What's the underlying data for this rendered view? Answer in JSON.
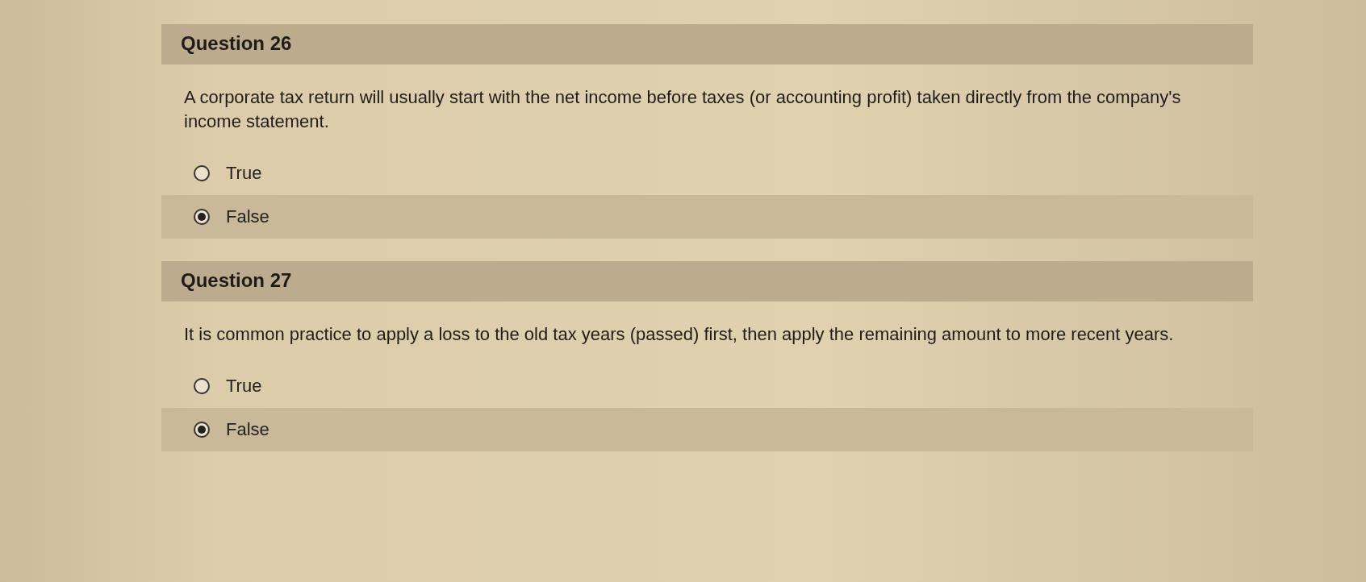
{
  "questions": [
    {
      "title": "Question 26",
      "text": "A corporate tax return will usually start with the net income before taxes (or accounting profit) taken directly from the company's income statement.",
      "options": [
        {
          "label": "True",
          "selected": false
        },
        {
          "label": "False",
          "selected": true
        }
      ]
    },
    {
      "title": "Question 27",
      "text": "It is common practice to apply a loss to the old tax years (passed) first, then apply the remaining amount to more recent years.",
      "options": [
        {
          "label": "True",
          "selected": false
        },
        {
          "label": "False",
          "selected": true
        }
      ]
    }
  ]
}
